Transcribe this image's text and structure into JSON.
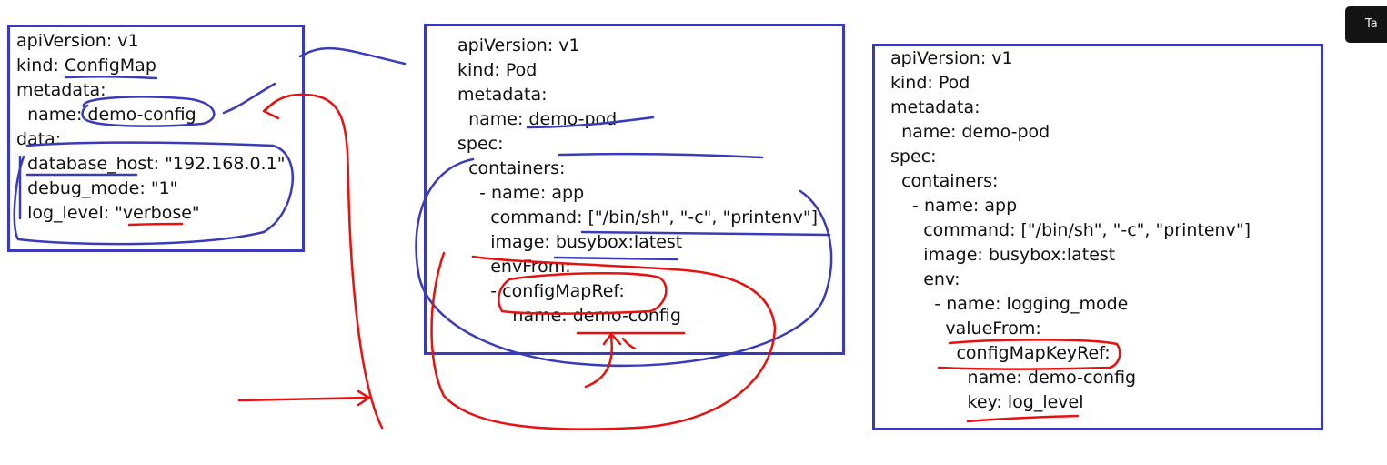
{
  "configmap": {
    "lines": [
      "apiVersion: v1",
      "kind: ConfigMap",
      "metadata:",
      "  name: demo-config",
      "data:",
      "  database_host: \"192.168.0.1\"",
      "  debug_mode: \"1\"",
      "  log_level: \"verbose\""
    ]
  },
  "pod_envfrom": {
    "lines": [
      "apiVersion: v1",
      "kind: Pod",
      "metadata:",
      "  name: demo-pod",
      "spec:",
      "  containers:",
      "    - name: app",
      "      command: [\"/bin/sh\", \"-c\", \"printenv\"]",
      "      image: busybox:latest",
      "      envFrom:",
      "      - configMapRef:",
      "          name: demo-config"
    ]
  },
  "pod_env": {
    "lines": [
      "apiVersion: v1",
      "kind: Pod",
      "metadata:",
      "  name: demo-pod",
      "spec:",
      "  containers:",
      "    - name: app",
      "      command: [\"/bin/sh\", \"-c\", \"printenv\"]",
      "      image: busybox:latest",
      "      env:",
      "        - name: logging_mode",
      "          valueFrom:",
      "            configMapKeyRef:",
      "              name: demo-config",
      "              key: log_level"
    ]
  },
  "corner_tab": {
    "label": "Ta"
  },
  "colors": {
    "box_border": "#3a3bb8",
    "annotation_blue": "#3a3bb8",
    "annotation_red": "#e8110f"
  }
}
